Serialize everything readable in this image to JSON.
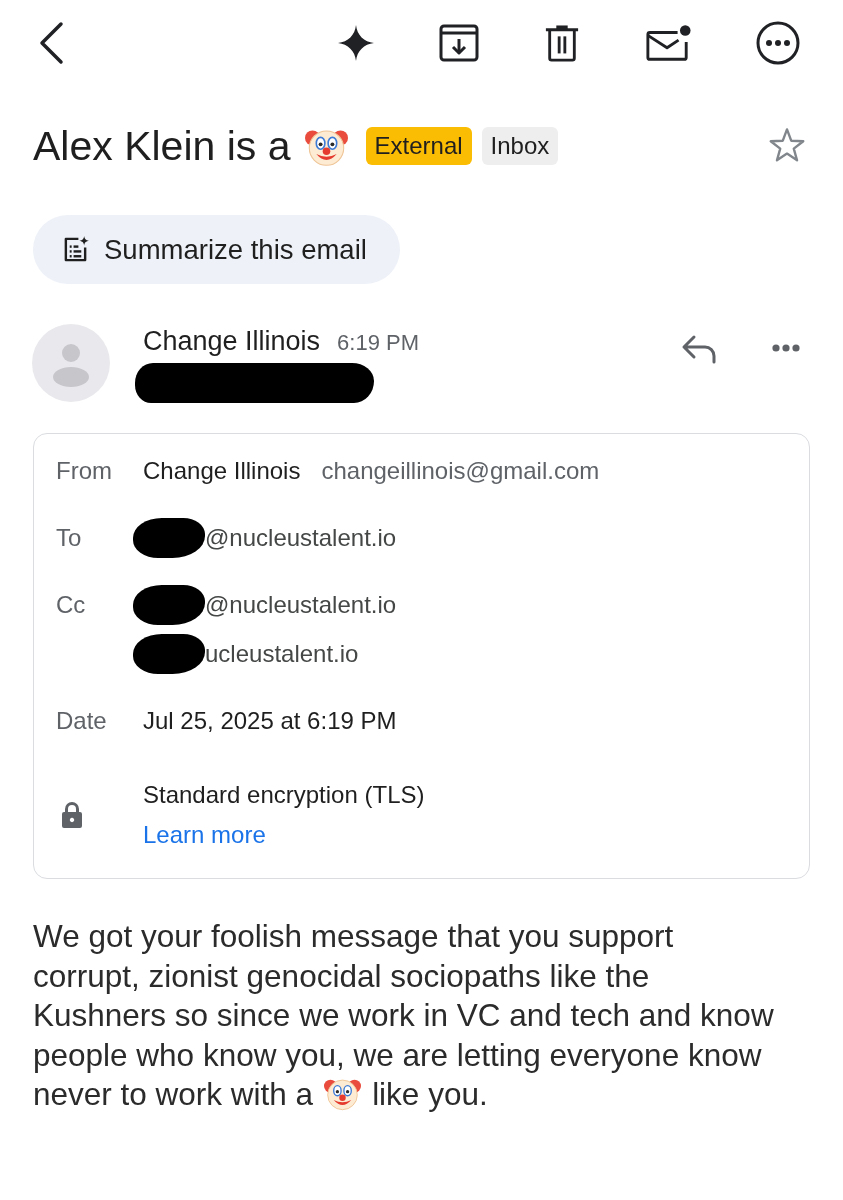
{
  "subject": {
    "segments": [
      {
        "kind": "text",
        "text": "Alex Klein is a"
      },
      {
        "kind": "emoji"
      }
    ],
    "labels": [
      {
        "text": "External",
        "color": "#fbbc04"
      },
      {
        "text": "Inbox",
        "color": "#eeeeee"
      }
    ],
    "starred": false
  },
  "summarize_button": {
    "label": "Summarize this email"
  },
  "message_header": {
    "sender": "Change Illinois",
    "time": "6:19 PM",
    "recipient_redacted": true
  },
  "details": {
    "from": {
      "label": "From",
      "name": "Change Illinois",
      "email": "changeillinois@gmail.com"
    },
    "to": {
      "label": "To",
      "addresses": [
        {
          "text": "@nucleustalent.io",
          "redacted": true
        }
      ]
    },
    "cc": {
      "label": "Cc",
      "addresses": [
        {
          "text": "@nucleustalent.io",
          "redacted": true
        },
        {
          "text": "ucleustalent.io",
          "redacted": true
        }
      ]
    },
    "date": {
      "label": "Date",
      "value": "Jul 25, 2025 at 6:19 PM"
    },
    "security": {
      "text": "Standard encryption (TLS)",
      "link": "Learn more"
    }
  },
  "body": {
    "segments": [
      {
        "kind": "text",
        "text": "We got your foolish message that you support corrupt, zionist genocidal sociopaths like the Kushners so since we work in VC and tech and know people who know you, we are letting everyone know never to work with a"
      },
      {
        "kind": "emoji"
      },
      {
        "kind": "text",
        "text": "like you."
      }
    ]
  }
}
